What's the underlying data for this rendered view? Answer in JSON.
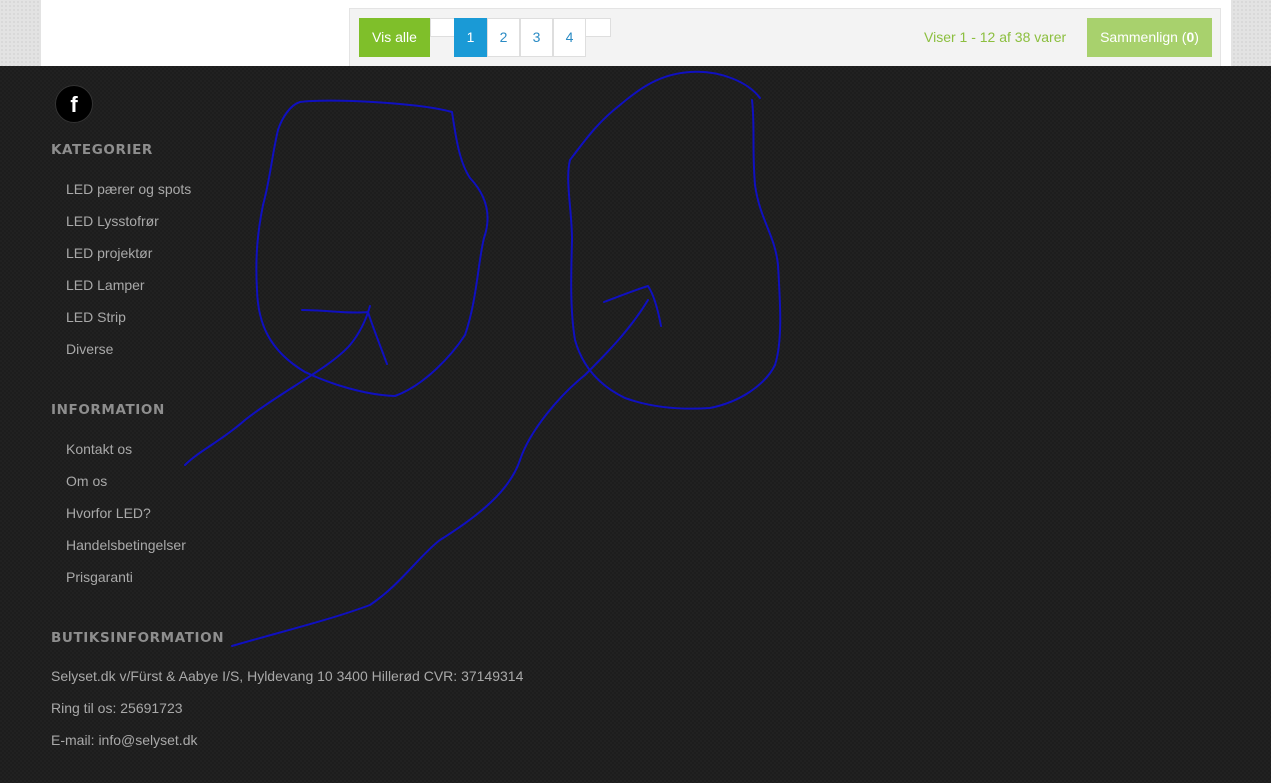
{
  "toolbar": {
    "show_all_label": "Vis alle",
    "pages": [
      "1",
      "2",
      "3",
      "4"
    ],
    "active_page": "1",
    "result_count": "Viser 1 - 12 af 38 varer",
    "compare_label": "Sammenlign (",
    "compare_count": "0",
    "compare_close": ")"
  },
  "footer": {
    "social": {
      "facebook_icon": "facebook-icon",
      "facebook_glyph": "f"
    },
    "categories": {
      "title": "KATEGORIER",
      "items": [
        "LED pærer og spots",
        "LED Lysstofrør",
        "LED projektør",
        "LED Lamper",
        "LED Strip",
        "Diverse"
      ]
    },
    "information": {
      "title": "INFORMATION",
      "items": [
        "Kontakt os",
        "Om os",
        "Hvorfor LED?",
        "Handelsbetingelser",
        "Prisgaranti"
      ]
    },
    "store_info": {
      "title": "BUTIKSINFORMATION",
      "address": "Selyset.dk v/Fürst & Aabye I/S, Hyldevang 10 3400 Hillerød CVR: 37149314",
      "phone": "Ring til os: 25691723",
      "email": "E-mail: info@selyset.dk"
    }
  },
  "colors": {
    "green_button": "#7fbf2a",
    "light_green_button": "#a8d16d",
    "active_page": "#1a9ad6",
    "result_text": "#8cbf3f",
    "footer_bg": "#1d1d1d",
    "footer_title": "#8e8e8e",
    "footer_link": "#a9a9a9",
    "annotation_ink": "#1010c0"
  }
}
